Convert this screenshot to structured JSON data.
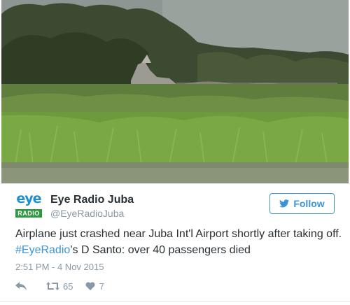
{
  "account": {
    "display_name": "Eye Radio Juba",
    "handle": "@EyeRadioJuba",
    "avatar_top_text": "eye",
    "avatar_bottom_text": "RADIO"
  },
  "follow_button": {
    "label": "Follow",
    "icon": "bird-icon"
  },
  "tweet": {
    "line1": "Airplane just crashed near Juba Int'l Airport shortly after taking off.",
    "hashtag": "#EyeRadio",
    "line2_rest": "’s D Santo: over 40 passengers died",
    "timestamp": "2:51 PM - 4 Nov 2015"
  },
  "actions": {
    "reply_icon": "reply-icon",
    "retweet_icon": "retweet-icon",
    "retweet_count": "65",
    "like_icon": "heart-icon",
    "like_count": "7"
  },
  "colors": {
    "link_blue": "#3b94d9",
    "muted_gray": "#8899a6",
    "text_dark": "#292f33",
    "logo_blue": "#1d8fd1",
    "logo_green": "#2d9a3f"
  }
}
